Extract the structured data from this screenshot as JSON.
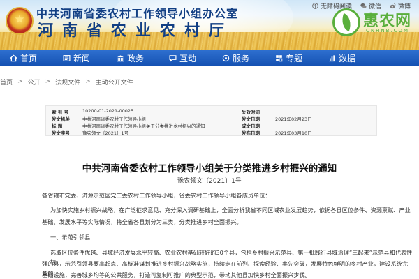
{
  "header": {
    "org_name": "中共河南省委农村工作领导小组办公室",
    "dept_name": "河南省农业农村厅",
    "util_links": [
      {
        "label": "无障碍阅读",
        "icon": "accessibility-icon"
      },
      {
        "label": "微信",
        "icon": "wechat-icon"
      },
      {
        "label": "微博",
        "icon": "weibo-icon"
      }
    ],
    "watermark": {
      "text": "惠农网",
      "url": "CNHNB.COM"
    }
  },
  "nav": {
    "items": [
      {
        "label": "首页",
        "icon": "home-icon"
      },
      {
        "label": "新闻",
        "icon": "news-icon"
      },
      {
        "label": "政务",
        "icon": "government-icon"
      },
      {
        "label": "互动",
        "icon": "chat-icon"
      },
      {
        "label": "服务",
        "icon": "service-icon"
      },
      {
        "label": "专题",
        "icon": "topic-icon"
      },
      {
        "label": "数据",
        "icon": "data-icon"
      }
    ]
  },
  "breadcrumb": [
    "首页",
    "公开",
    "法规文件",
    "主动公开文件"
  ],
  "meta": {
    "index_label": "索 引 号",
    "index_value": "10200-01-2021-00025",
    "effect_label": "失效时间",
    "effect_value": "",
    "issuer_label": "发文机关",
    "issuer_value": "中共河南省委农村工作领导小组",
    "issue_date_label": "发文日期",
    "issue_date_value": "2021年02月23日",
    "title_label": "标 题",
    "title_value": "中共河南省委农村工作领导小组关于分类推进乡村振兴的通知",
    "create_label": "成文日期",
    "create_value": "",
    "docno_label": "发文字号",
    "docno_value": "豫农领文〔2021〕1号",
    "pub_date_label": "发布日期",
    "pub_date_value": "2021年03月10日"
  },
  "article": {
    "title": "中共河南省委农村工作领导小组关于分类推进乡村振兴的通知",
    "doc_no": "豫农领文〔2021〕1号",
    "addressee": "各省辖市党委、济源示范区党工委农村工作领导小组，省委农村工作领导小组各成员单位：",
    "intro_line1": "为加快实施乡村振兴战略，在广泛征求意见、充分深入调研基础上，全面分析我省不同区域农业发展趋势，依据各县区位条件、资源禀赋、产业",
    "intro_line2": "基础、发展水平等实际情况，将全省各县划分为三类，分类推进乡村全面振兴。",
    "section1": "一、示范引领县",
    "body_line1": "选取区位条件优越、县域经济发展水平较高、农业农村基础较好的30个县，包括乡村振兴示范县、第一批践行县域治理“三起来”示范县和代表性较",
    "body_line2": "强的县，示范引领县要高起点、高标准谋划推进乡村振兴战略实施，持续走在前列、探索经验、率先突破，发展特色鲜明的乡村产业，建设系统完备的",
    "body_line3": "基础设施，完善城乡均等的公共服务，打造可复制可推广的典型示范，带动其他县加快乡村全面振兴步伐。"
  },
  "colors": {
    "nav_blue": "#1552b3",
    "title_blue": "#123f84",
    "watermark_green": "#5aaf3c"
  }
}
